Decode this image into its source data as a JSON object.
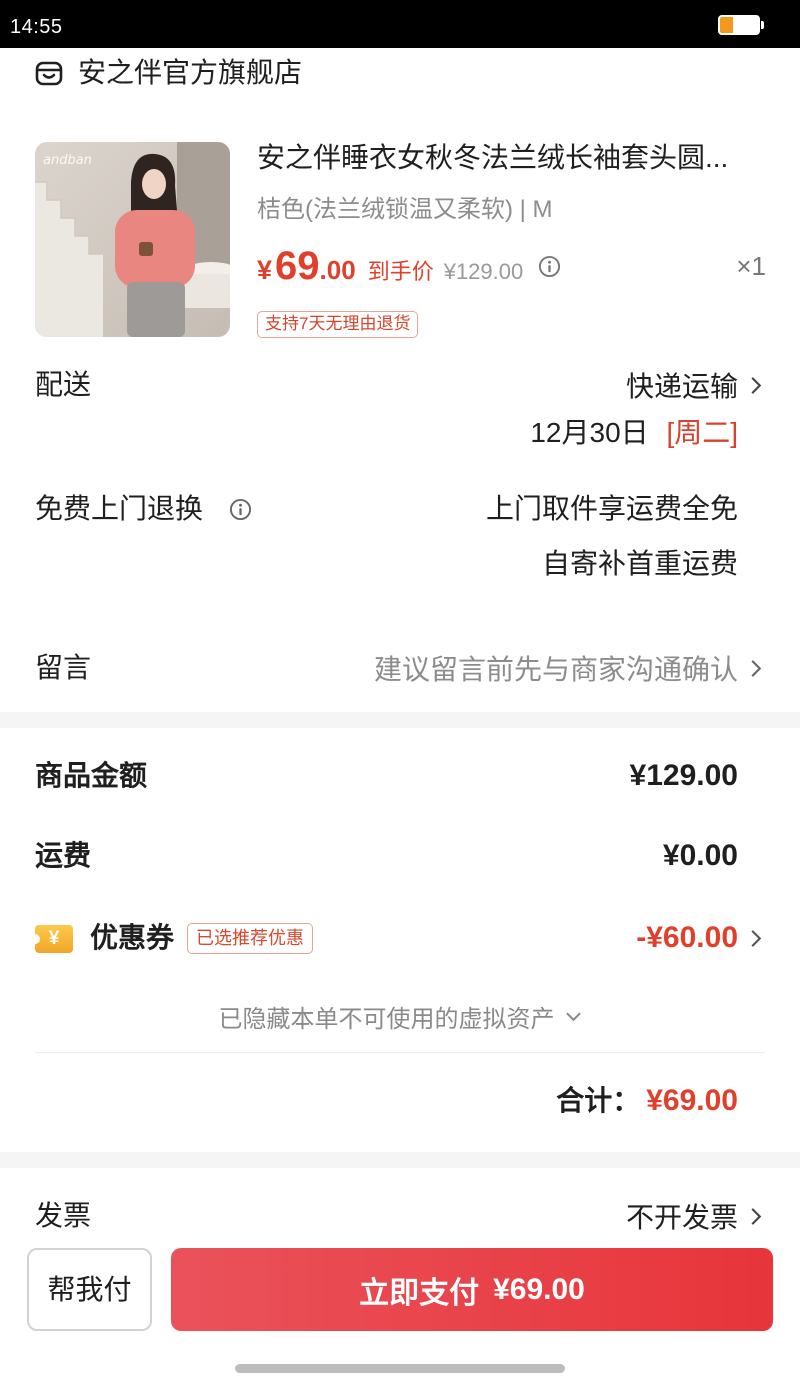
{
  "status_bar": {
    "time": "14:55",
    "battery_level": 0.35
  },
  "store": {
    "name": "安之伴官方旗舰店",
    "icon": "store-icon"
  },
  "product": {
    "image_watermark": "andban",
    "title": "安之伴睡衣女秋冬法兰绒长袖套头圆...",
    "spec": "桔色(法兰绒锁温又柔软) | M",
    "price": {
      "currency": "¥",
      "integer": "69",
      "decimal": ".00"
    },
    "final_price_label": "到手价",
    "original_price": "¥129.00",
    "quantity": "×1",
    "return_policy_tag": "支持7天无理由退货"
  },
  "delivery": {
    "label": "配送",
    "method": "快递运输",
    "date": "12月30日",
    "weekday": "[周二]"
  },
  "home_return": {
    "label": "免费上门退换",
    "line1": "上门取件享运费全免",
    "line2": "自寄补首重运费"
  },
  "message": {
    "label": "留言",
    "placeholder": "建议留言前先与商家沟通确认"
  },
  "summary": {
    "goods_amount": {
      "label": "商品金额",
      "value": "¥129.00"
    },
    "shipping": {
      "label": "运费",
      "value": "¥0.00"
    },
    "coupon": {
      "label": "优惠券",
      "tag": "已选推荐优惠",
      "value": "-¥60.00",
      "icon": "coupon-icon"
    },
    "hidden_assets_note": "已隐藏本单不可使用的虚拟资产",
    "total": {
      "label": "合计：",
      "value": "¥69.00"
    }
  },
  "invoice": {
    "label": "发票",
    "value": "不开发票"
  },
  "bottom_bar": {
    "help_pay": "帮我付",
    "pay_label": "立即支付",
    "pay_amount": "¥69.00"
  },
  "colors": {
    "accent_red": "#e7353a",
    "price_red": "#e0402b",
    "text_primary": "#1f1f1f",
    "text_secondary": "#8c8c8c",
    "coupon_yellow": "#f3a526",
    "section_gap": "#f5f5f5",
    "battery_orange": "#f39a1e"
  }
}
